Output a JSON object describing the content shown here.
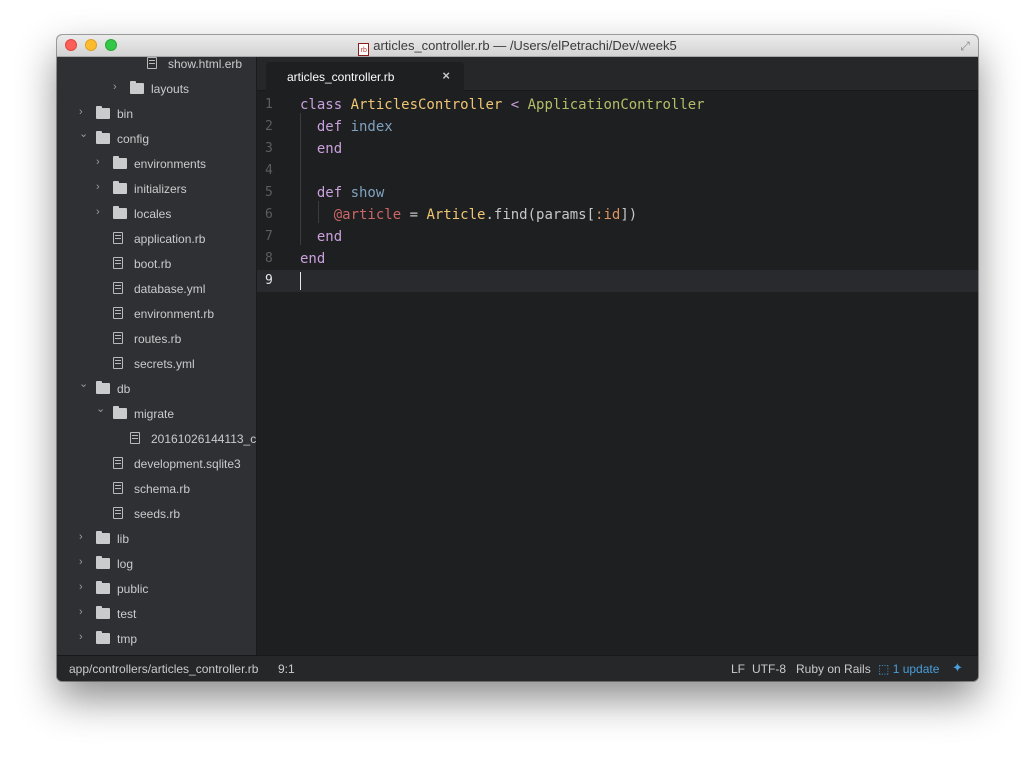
{
  "window": {
    "title": "articles_controller.rb — /Users/elPetrachi/Dev/week5",
    "title_icon": "rb",
    "accent": "#4a9eda"
  },
  "sidebar": {
    "items": [
      {
        "label": "show.html.erb",
        "type": "file",
        "depth": 4
      },
      {
        "label": "layouts",
        "type": "folder",
        "depth": 3,
        "expanded": false
      },
      {
        "label": "bin",
        "type": "folder",
        "depth": 1,
        "expanded": false
      },
      {
        "label": "config",
        "type": "folder",
        "depth": 1,
        "expanded": true
      },
      {
        "label": "environments",
        "type": "folder",
        "depth": 2,
        "expanded": false
      },
      {
        "label": "initializers",
        "type": "folder",
        "depth": 2,
        "expanded": false
      },
      {
        "label": "locales",
        "type": "folder",
        "depth": 2,
        "expanded": false
      },
      {
        "label": "application.rb",
        "type": "file",
        "depth": 2
      },
      {
        "label": "boot.rb",
        "type": "file",
        "depth": 2
      },
      {
        "label": "database.yml",
        "type": "file",
        "depth": 2
      },
      {
        "label": "environment.rb",
        "type": "file",
        "depth": 2
      },
      {
        "label": "routes.rb",
        "type": "file",
        "depth": 2
      },
      {
        "label": "secrets.yml",
        "type": "file",
        "depth": 2
      },
      {
        "label": "db",
        "type": "folder",
        "depth": 1,
        "expanded": true
      },
      {
        "label": "migrate",
        "type": "folder",
        "depth": 2,
        "expanded": true
      },
      {
        "label": "20161026144113_c",
        "type": "file",
        "depth": 3
      },
      {
        "label": "development.sqlite3",
        "type": "file",
        "depth": 2
      },
      {
        "label": "schema.rb",
        "type": "file",
        "depth": 2
      },
      {
        "label": "seeds.rb",
        "type": "file",
        "depth": 2
      },
      {
        "label": "lib",
        "type": "folder",
        "depth": 1,
        "expanded": false
      },
      {
        "label": "log",
        "type": "folder",
        "depth": 1,
        "expanded": false
      },
      {
        "label": "public",
        "type": "folder",
        "depth": 1,
        "expanded": false
      },
      {
        "label": "test",
        "type": "folder",
        "depth": 1,
        "expanded": false
      },
      {
        "label": "tmp",
        "type": "folder",
        "depth": 1,
        "expanded": false
      }
    ]
  },
  "tabs": [
    {
      "label": "articles_controller.rb",
      "active": true
    }
  ],
  "editor": {
    "active_line": 9,
    "lines": [
      {
        "num": "1",
        "tokens": [
          [
            "kw",
            "class "
          ],
          [
            "cls",
            "ArticlesController"
          ],
          [
            "plain",
            " "
          ],
          [
            "kw",
            "<"
          ],
          [
            "plain",
            " "
          ],
          [
            "parent",
            "ApplicationController"
          ]
        ]
      },
      {
        "num": "2",
        "tokens": [
          [
            "plain",
            "  "
          ],
          [
            "kw",
            "def "
          ],
          [
            "fn",
            "index"
          ]
        ]
      },
      {
        "num": "3",
        "tokens": [
          [
            "plain",
            "  "
          ],
          [
            "kw",
            "end"
          ]
        ]
      },
      {
        "num": "4",
        "tokens": []
      },
      {
        "num": "5",
        "tokens": [
          [
            "plain",
            "  "
          ],
          [
            "kw",
            "def "
          ],
          [
            "fn",
            "show"
          ]
        ]
      },
      {
        "num": "6",
        "tokens": [
          [
            "plain",
            "    "
          ],
          [
            "ivar",
            "@article"
          ],
          [
            "plain",
            " = "
          ],
          [
            "cls",
            "Article"
          ],
          [
            "plain",
            ".find(params["
          ],
          [
            "sym",
            ":id"
          ],
          [
            "plain",
            "])"
          ]
        ]
      },
      {
        "num": "7",
        "tokens": [
          [
            "plain",
            "  "
          ],
          [
            "kw",
            "end"
          ]
        ]
      },
      {
        "num": "8",
        "tokens": [
          [
            "kw",
            "end"
          ]
        ]
      },
      {
        "num": "9",
        "tokens": []
      }
    ]
  },
  "statusbar": {
    "path": "app/controllers/articles_controller.rb",
    "cursor": "9:1",
    "line_ending": "LF",
    "encoding": "UTF-8",
    "grammar": "Ruby on Rails",
    "update": "1 update"
  }
}
